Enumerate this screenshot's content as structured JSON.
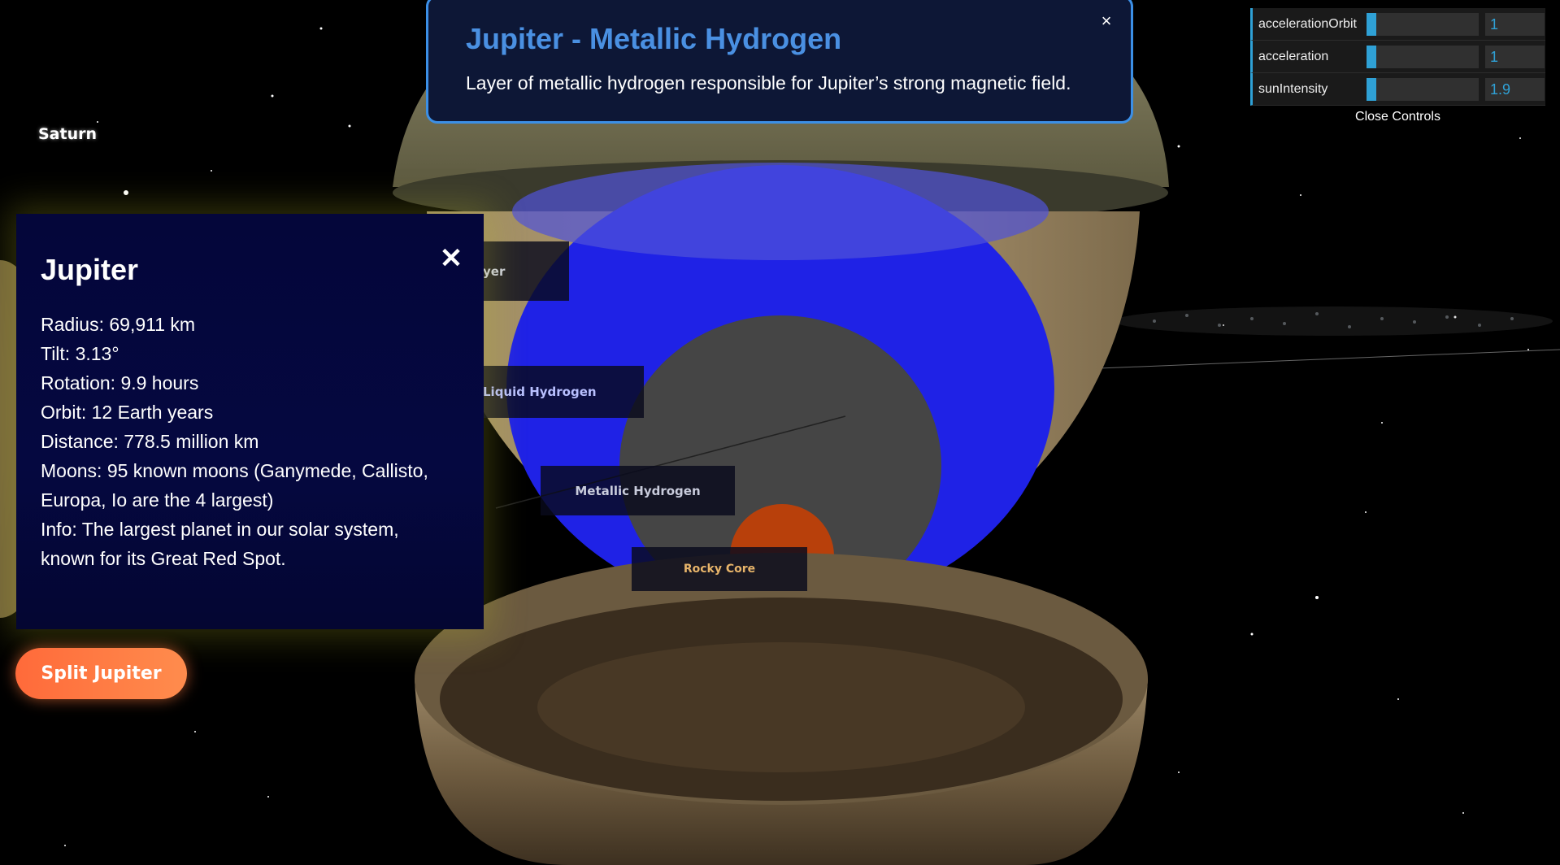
{
  "scene": {
    "planet_labels": {
      "saturn": "Saturn"
    },
    "layer_labels": {
      "outer": "yer",
      "liquid": "Liquid Hydrogen",
      "metallic": "Metallic Hydrogen",
      "core": "Rocky Core"
    }
  },
  "info_panel": {
    "close": "✕",
    "title": "Jupiter",
    "lines": [
      "Radius: 69,911 km",
      "Tilt: 3.13°",
      "Rotation: 9.9 hours",
      "Orbit: 12 Earth years",
      "Distance: 778.5 million km",
      "Moons: 95 known moons (Ganymede, Callisto,",
      "Europa, Io are the 4 largest)",
      "Info: The largest planet in our solar system,",
      "known for its Great Red Spot."
    ]
  },
  "split_button": {
    "label": "Split Jupiter"
  },
  "layer_popup": {
    "close": "×",
    "title": "Jupiter - Metallic Hydrogen",
    "description": "Layer of metallic hydrogen responsible for Jupiter’s strong magnetic field."
  },
  "controls": {
    "rows": [
      {
        "label": "accelerationOrbit",
        "value": "1",
        "fraction": 0.09
      },
      {
        "label": "acceleration",
        "value": "1",
        "fraction": 0.09
      },
      {
        "label": "sunIntensity",
        "value": "1.9",
        "fraction": 0.09
      }
    ],
    "close_label": "Close Controls"
  },
  "colors": {
    "accent": "#2fa1d6",
    "popup_title": "#4a90e2",
    "button": "#ff7a45",
    "panel_bg": "#04063a"
  }
}
